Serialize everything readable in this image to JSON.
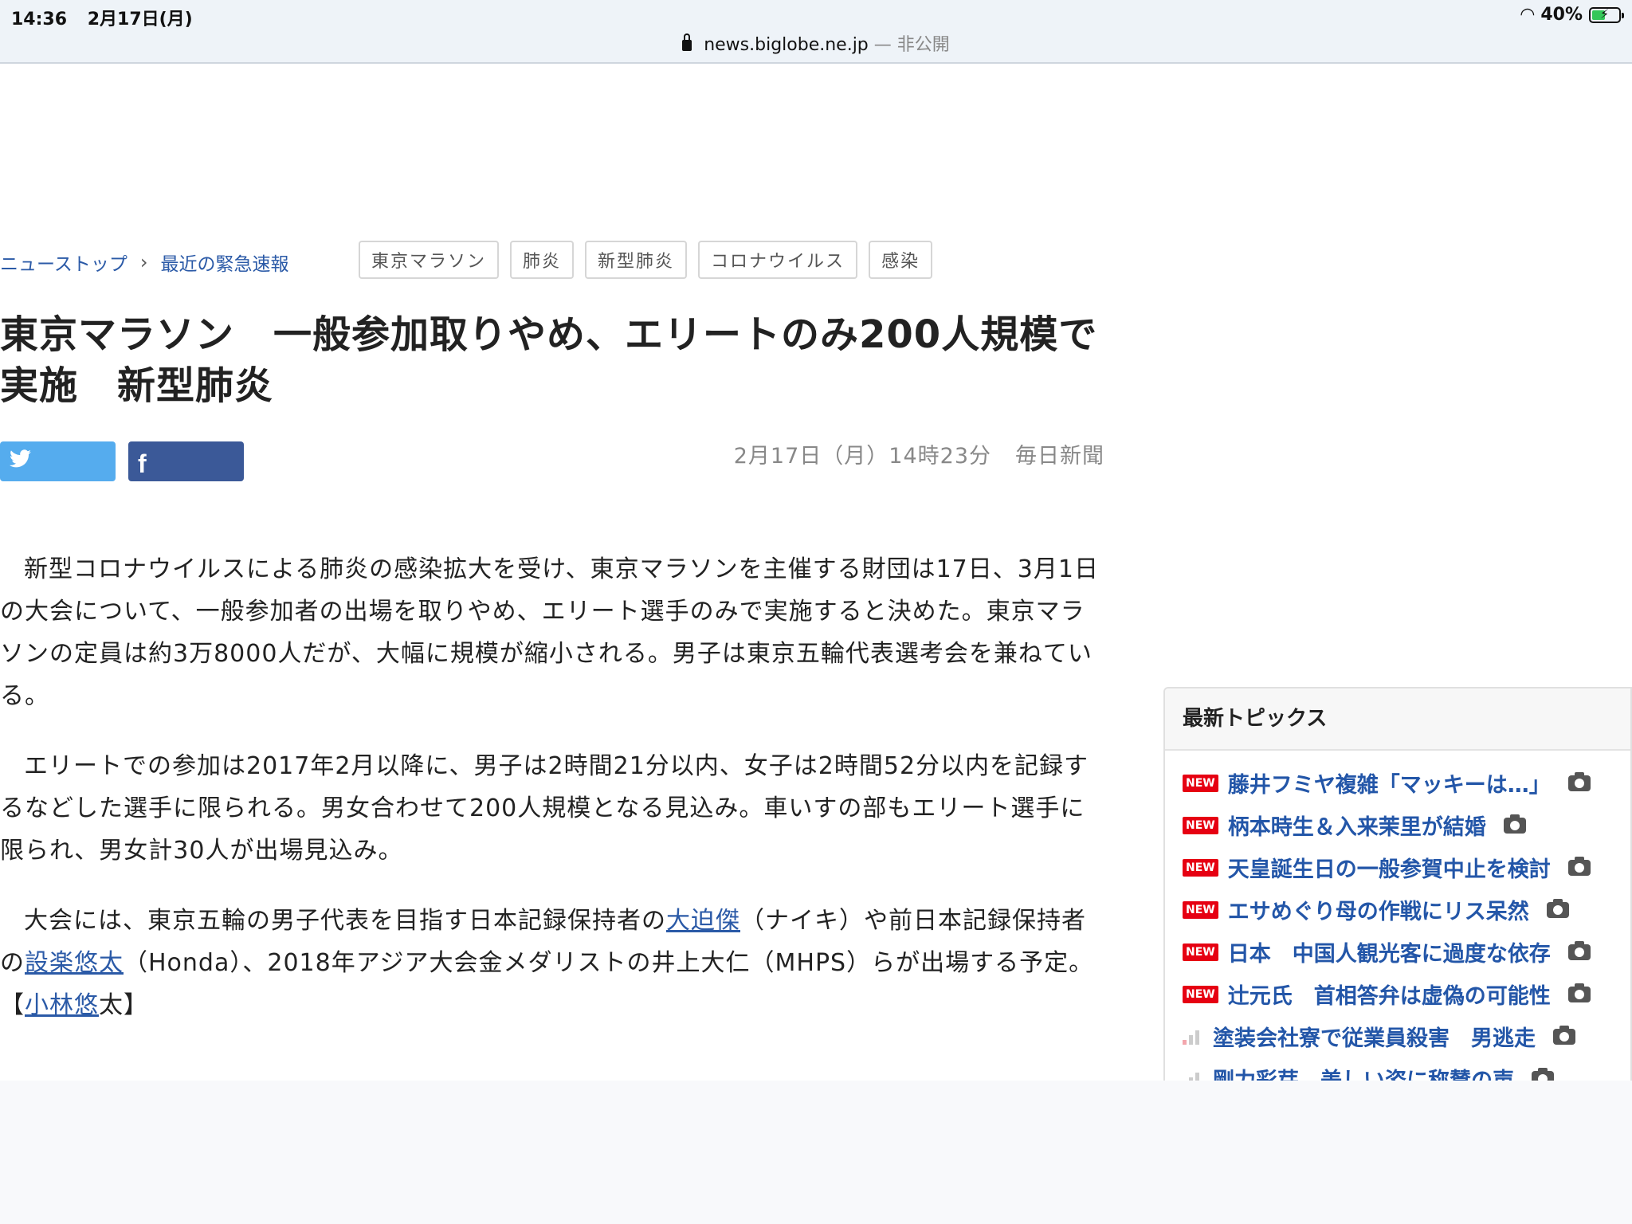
{
  "status": {
    "time": "14:36",
    "date": "2月17日(月)",
    "battery": "40%",
    "wifi_icon": "wifi-icon",
    "battery_icon": "battery-charging-icon"
  },
  "url": {
    "domain": "news.biglobe.ne.jp",
    "separator": "—",
    "mode": "非公開"
  },
  "breadcrumb": {
    "home": "ニューストップ",
    "current": "最近の緊急速報"
  },
  "tags": [
    "東京マラソン",
    "肺炎",
    "新型肺炎",
    "コロナウイルス",
    "感染"
  ],
  "article": {
    "title": "東京マラソン　一般参加取りやめ、エリートのみ200人規模で実施　新型肺炎",
    "date": "2月17日（月）14時23分",
    "source": "毎日新聞",
    "p1": "新型コロナウイルスによる肺炎の感染拡大を受け、東京マラソンを主催する財団は17日、3月1日の大会について、一般参加者の出場を取りやめ、エリート選手のみで実施すると決めた。東京マラソンの定員は約3万8000人だが、大幅に規模が縮小される。男子は東京五輪代表選考会を兼ねている。",
    "p2": "エリートでの参加は2017年2月以降に、男子は2時間21分以内、女子は2時間52分以内を記録するなどした選手に限られる。男女合わせて200人規模となる見込み。車いすの部もエリート選手に限られ、男女計30人が出場見込み。",
    "p3_a": "大会には、東京五輪の男子代表を目指す日本記録保持者の",
    "p3_link1": "大迫傑",
    "p3_b": "（ナイキ）や前日本記録保持者の",
    "p3_link2": "設楽悠太",
    "p3_c": "（Honda）、2018年アジア大会金メダリストの井上大仁（MHPS）らが出場する予定。【",
    "p3_link3": "小林悠",
    "p3_d": "太】"
  },
  "share": {
    "twitter_icon": "twitter-icon",
    "facebook_icon": "facebook-icon",
    "facebook_glyph": "f"
  },
  "topics": {
    "heading": "最新トピックス",
    "new_label": "NEW",
    "items": [
      {
        "title": "藤井フミヤ複雑「マッキーは…」",
        "badge": "new"
      },
      {
        "title": "柄本時生＆入来茉里が結婚",
        "badge": "new"
      },
      {
        "title": "天皇誕生日の一般参賀中止を検討",
        "badge": "new"
      },
      {
        "title": "エサめぐり母の作戦にリス呆然",
        "badge": "new"
      },
      {
        "title": "日本　中国人観光客に過度な依存",
        "badge": "new"
      },
      {
        "title": "辻元氏　首相答弁は虚偽の可能性",
        "badge": "new"
      },
      {
        "title": "塗装会社寮で従業員殺害　男逃走",
        "badge": "rank"
      },
      {
        "title": "剛力彩芽　美しい姿に称賛の声",
        "badge": "rank"
      }
    ]
  }
}
